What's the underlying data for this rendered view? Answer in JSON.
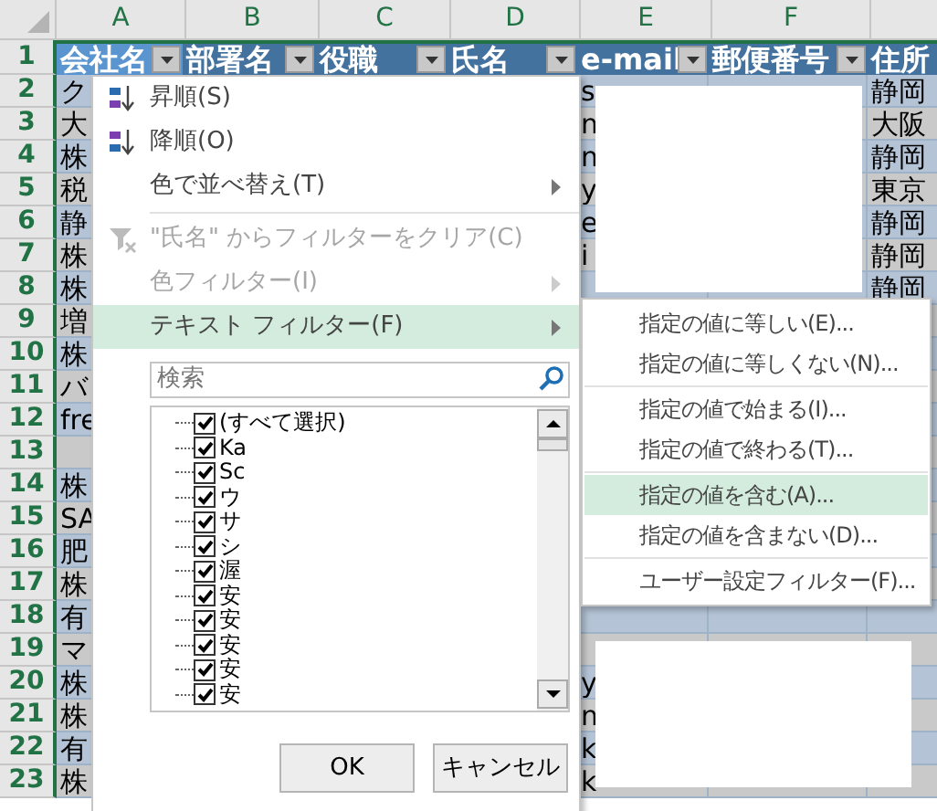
{
  "sheet": {
    "column_headers": [
      "A",
      "B",
      "C",
      "D",
      "E",
      "F"
    ],
    "header_row": {
      "number": "1",
      "cells": [
        {
          "text": "会社名",
          "selected": true
        },
        {
          "text": "部署名",
          "selected": false
        },
        {
          "text": "役職",
          "selected": false
        },
        {
          "text": "氏名",
          "selected": false
        },
        {
          "text": "e-mail",
          "selected": false
        },
        {
          "text": "郵便番号",
          "selected": false
        },
        {
          "text": "住所",
          "selected": false
        }
      ]
    },
    "rows": [
      {
        "number": "2",
        "a": "ク",
        "e": "s",
        "g": "静岡"
      },
      {
        "number": "3",
        "a": "大",
        "e": "n",
        "g": "大阪"
      },
      {
        "number": "4",
        "a": "株",
        "e": "n",
        "g": "静岡"
      },
      {
        "number": "5",
        "a": "税",
        "e": "y",
        "g": "東京"
      },
      {
        "number": "6",
        "a": "静",
        "e": "e",
        "g": "静岡"
      },
      {
        "number": "7",
        "a": "株",
        "e": "i",
        "g": "静岡"
      },
      {
        "number": "8",
        "a": "株",
        "g": "静岡"
      },
      {
        "number": "9",
        "a": "増"
      },
      {
        "number": "10",
        "a": "株"
      },
      {
        "number": "11",
        "a": "バ"
      },
      {
        "number": "12",
        "a": "fre"
      },
      {
        "number": "13"
      },
      {
        "number": "14",
        "a": "株"
      },
      {
        "number": "15",
        "a": "SA"
      },
      {
        "number": "16",
        "a": "肥"
      },
      {
        "number": "17",
        "a": "株"
      },
      {
        "number": "18",
        "a": "有"
      },
      {
        "number": "19",
        "a": "マ"
      },
      {
        "number": "20",
        "a": "株",
        "e": "y"
      },
      {
        "number": "21",
        "a": "株",
        "e": "n"
      },
      {
        "number": "22",
        "a": "有",
        "e": "k"
      },
      {
        "number": "23",
        "a": "株",
        "e": "k"
      }
    ]
  },
  "filter_menu": {
    "items": [
      {
        "kind": "sort_asc",
        "label": "昇順(S)",
        "disabled": false,
        "submenu": false,
        "selected": false
      },
      {
        "kind": "sort_desc",
        "label": "降順(O)",
        "disabled": false,
        "submenu": false,
        "selected": false
      },
      {
        "kind": "plain",
        "label": "色で並べ替え(T)",
        "disabled": false,
        "submenu": true,
        "selected": false
      },
      {
        "kind": "separator"
      },
      {
        "kind": "clear",
        "label": "\"氏名\" からフィルターをクリア(C)",
        "disabled": true,
        "submenu": false,
        "selected": false
      },
      {
        "kind": "plain",
        "label": "色フィルター(I)",
        "disabled": true,
        "submenu": true,
        "selected": false
      },
      {
        "kind": "plain",
        "label": "テキスト フィルター(F)",
        "disabled": false,
        "submenu": true,
        "selected": true
      }
    ],
    "search": {
      "placeholder": "検索"
    },
    "values": [
      {
        "label": "(すべて選択)",
        "checked": true
      },
      {
        "label": "Ka",
        "checked": true
      },
      {
        "label": "Sc",
        "checked": true
      },
      {
        "label": "ウ",
        "checked": true
      },
      {
        "label": "サ",
        "checked": true
      },
      {
        "label": "シ",
        "checked": true
      },
      {
        "label": "渥",
        "checked": true
      },
      {
        "label": "安",
        "checked": true
      },
      {
        "label": "安",
        "checked": true
      },
      {
        "label": "安",
        "checked": true
      },
      {
        "label": "安",
        "checked": true
      },
      {
        "label": "安",
        "checked": true
      }
    ],
    "buttons": [
      "OK",
      "キャンセル"
    ]
  },
  "text_filter_submenu": {
    "items": [
      {
        "kind": "item",
        "label": "指定の値に等しい(E)...",
        "selected": false
      },
      {
        "kind": "item",
        "label": "指定の値に等しくない(N)...",
        "selected": false
      },
      {
        "kind": "separator"
      },
      {
        "kind": "item",
        "label": "指定の値で始まる(I)...",
        "selected": false
      },
      {
        "kind": "item",
        "label": "指定の値で終わる(T)...",
        "selected": false
      },
      {
        "kind": "separator"
      },
      {
        "kind": "item",
        "label": "指定の値を含む(A)...",
        "selected": true
      },
      {
        "kind": "item",
        "label": "指定の値を含まない(D)...",
        "selected": false
      },
      {
        "kind": "separator"
      },
      {
        "kind": "item",
        "label": "ユーザー設定フィルター(F)...",
        "selected": false
      }
    ]
  }
}
